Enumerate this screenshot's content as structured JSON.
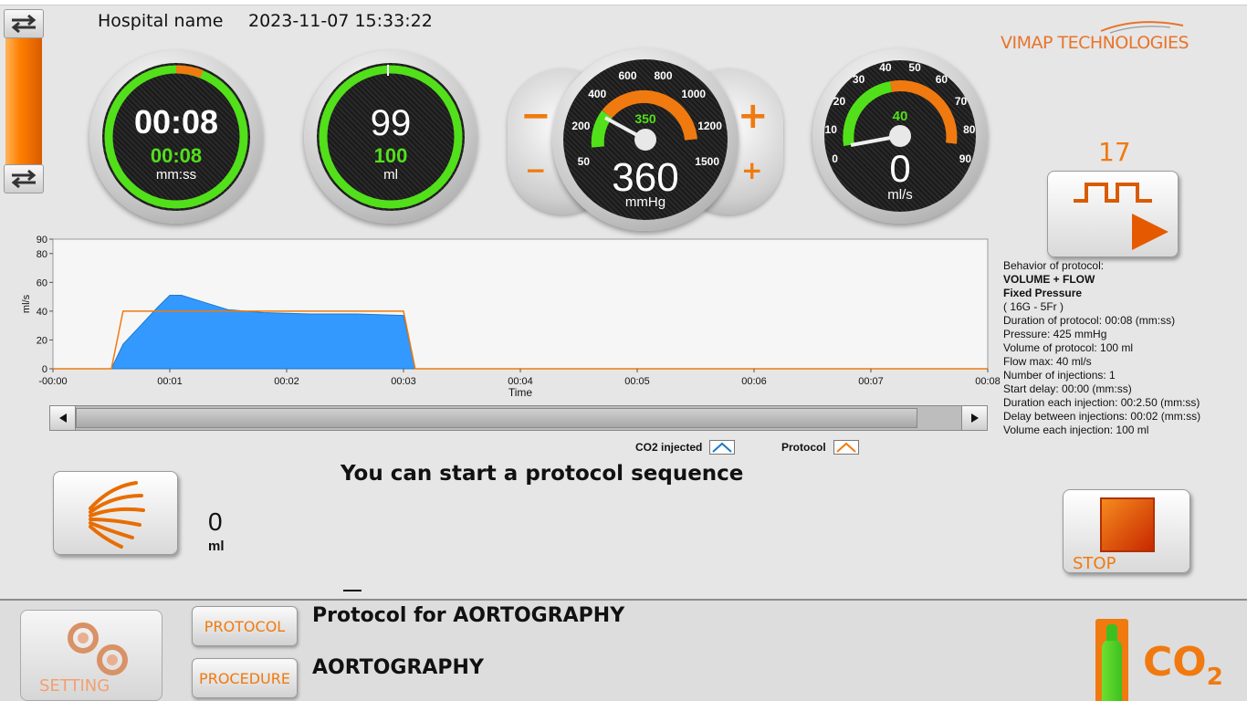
{
  "header": {
    "hospital_name": "Hospital name",
    "datetime": "2023-11-07 15:33:22"
  },
  "logo": {
    "text": "VIMAP TECHNOLOGIES"
  },
  "slider": {
    "up_icon": "swap-arrows-icon",
    "down_icon": "swap-arrows-icon",
    "fill_fraction": 1.0,
    "color": "#ff7f00"
  },
  "gauge_time": {
    "value": "00:08",
    "target": "00:08",
    "unit": "mm:ss",
    "progress_fraction": 0.88,
    "ring_color": "#52e01a",
    "accent_color": "#f07a10"
  },
  "gauge_volume": {
    "value": "99",
    "target": "100",
    "unit": "ml",
    "progress_fraction": 0.99
  },
  "gauge_pressure": {
    "value": "360",
    "setpoint": "350",
    "unit": "mmHg",
    "ticks": [
      "50",
      "200",
      "400",
      "600",
      "800",
      "1000",
      "1200",
      "1500"
    ],
    "minus_label": "−",
    "plus_label": "+"
  },
  "gauge_flow": {
    "value": "0",
    "setpoint": "40",
    "unit": "ml/s",
    "ticks": [
      "0",
      "10",
      "20",
      "30",
      "40",
      "50",
      "60",
      "70",
      "80",
      "90"
    ]
  },
  "pulse_button": {
    "count": "17",
    "icon": "square-wave-icon",
    "play_icon": "play-triangle-icon"
  },
  "protocol_info": {
    "lines": [
      {
        "text": "Behavior of protocol:",
        "bold": false
      },
      {
        "text": "VOLUME + FLOW",
        "bold": true
      },
      {
        "text": "Fixed Pressure",
        "bold": true
      },
      {
        "text": " ( 16G - 5Fr )",
        "bold": false
      },
      {
        "text": "Duration of protocol: 00:08 (mm:ss)",
        "bold": false
      },
      {
        "text": "Pressure: 425 mmHg",
        "bold": false
      },
      {
        "text": "Volume of protocol: 100 ml",
        "bold": false
      },
      {
        "text": "Flow max: 40 ml/s",
        "bold": false
      },
      {
        "text": "Number of injections: 1",
        "bold": false
      },
      {
        "text": "Start delay: 00:00 (mm:ss)",
        "bold": false
      },
      {
        "text": "Duration each injection: 00:2.50 (mm:ss)",
        "bold": false
      },
      {
        "text": "Delay between injections: 00:02 (mm:ss)",
        "bold": false
      },
      {
        "text": "Volume each injection: 100 ml",
        "bold": false
      }
    ]
  },
  "chart_data": {
    "type": "area",
    "xlabel": "Time",
    "ylabel": "ml/s",
    "xlim": [
      0,
      8
    ],
    "ylim": [
      0,
      90
    ],
    "x_ticks": [
      "-00:00",
      "00:01",
      "00:02",
      "00:03",
      "00:04",
      "00:05",
      "00:06",
      "00:07",
      "00:08"
    ],
    "y_ticks": [
      "0",
      "20",
      "40",
      "60",
      "80",
      "90"
    ],
    "series": [
      {
        "name": "CO2 injected",
        "color": "#3399ff",
        "x": [
          0,
          0.5,
          0.6,
          0.75,
          0.9,
          1.0,
          1.1,
          1.3,
          1.5,
          1.8,
          2.2,
          2.6,
          3.0,
          3.1,
          3.2,
          8
        ],
        "y": [
          0,
          0,
          17,
          30,
          43,
          51,
          51,
          46,
          41,
          39,
          38,
          38,
          37,
          0,
          0,
          0
        ]
      },
      {
        "name": "Protocol",
        "color": "#f07a10",
        "x": [
          0,
          0.5,
          0.6,
          3.0,
          3.1,
          8
        ],
        "y": [
          0,
          0,
          40,
          40,
          0,
          0
        ]
      }
    ],
    "grid": false,
    "legend_position": "bottom"
  },
  "legend": {
    "co2_label": "CO2 injected",
    "protocol_label": "Protocol"
  },
  "flush_button": {
    "icon": "spray-icon"
  },
  "flush_volume": {
    "value": "0",
    "unit": "ml"
  },
  "message": "You can start a protocol sequence",
  "stop_button": {
    "label": "STOP",
    "icon": "stop-square-icon"
  },
  "bottom": {
    "setting_label": "SETTING",
    "setting_icon": "gears-icon",
    "protocol_btn": "PROTOCOL",
    "procedure_btn": "PROCEDURE",
    "protocol_name": "Protocol for AORTOGRAPHY",
    "procedure_name": "AORTOGRAPHY",
    "gas_label": "CO",
    "gas_sub": "2",
    "cylinder_icon": "gas-cylinder-icon"
  }
}
